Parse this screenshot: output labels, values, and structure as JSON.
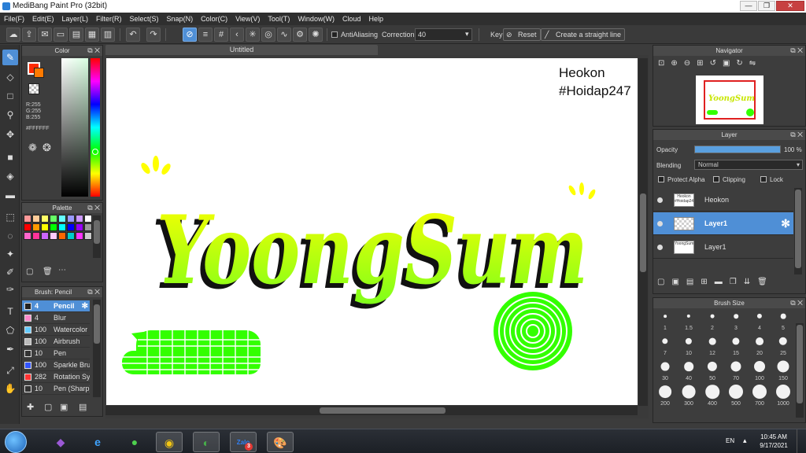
{
  "window": {
    "title": "MediBang Paint Pro (32bit)"
  },
  "menu": [
    "File(F)",
    "Edit(E)",
    "Layer(L)",
    "Filter(R)",
    "Select(S)",
    "Snap(N)",
    "Color(C)",
    "View(V)",
    "Tool(T)",
    "Window(W)",
    "Cloud",
    "Help"
  ],
  "toolbar": {
    "antialiasing_label": "AntiAliasing",
    "correction_label": "Correction",
    "correction_value": "40",
    "key_label": "Key",
    "reset_label": "Reset",
    "straight_line_label": "Create a straight line"
  },
  "color_panel": {
    "title": "Color",
    "r": "R:255",
    "g": "G:255",
    "b": "B:255",
    "hex": "#FFFFFF",
    "primary_color": "#ff2a00",
    "secondary_color": "#ffffff"
  },
  "palette": {
    "title": "Palette",
    "colors": [
      "#ff9999",
      "#ffcc99",
      "#ffff66",
      "#66ff66",
      "#66ffff",
      "#9999ff",
      "#cc99ff",
      "#ffffff",
      "#ff0000",
      "#ff9900",
      "#ffff00",
      "#00ff00",
      "#00ffff",
      "#0000ff",
      "#9900ff",
      "#999999",
      "#ff66cc",
      "#ff3399",
      "#cc66ff",
      "#ffccff",
      "#ff6600",
      "#00cccc",
      "#ff33ff",
      "#cccccc"
    ]
  },
  "brush_panel": {
    "title": "Brush: Pencil",
    "brushes": [
      {
        "size": "4",
        "name": "Pencil",
        "color": "#222222",
        "selected": true
      },
      {
        "size": "4",
        "name": "Blur",
        "color": "#ff88cc",
        "selected": false
      },
      {
        "size": "100",
        "name": "Watercolor",
        "color": "#66ccff",
        "selected": false
      },
      {
        "size": "100",
        "name": "Airbrush",
        "color": "#bbbbbb",
        "selected": false
      },
      {
        "size": "10",
        "name": "Pen",
        "color": "#333333",
        "selected": false
      },
      {
        "size": "100",
        "name": "Sparkle Brush",
        "color": "#3355ff",
        "selected": false
      },
      {
        "size": "282",
        "name": "Rotation Symmetry",
        "color": "#ff3333",
        "selected": false
      },
      {
        "size": "10",
        "name": "Pen (Sharp)",
        "color": "#333333",
        "selected": false
      }
    ]
  },
  "document": {
    "tab": "Untitled",
    "watermark_line1": "Heokon",
    "watermark_line2": "#Hoidap247",
    "artwork_text": "YoongSum"
  },
  "navigator": {
    "title": "Navigator"
  },
  "layer_panel": {
    "title": "Layer",
    "opacity_label": "Opacity",
    "opacity_value": "100 %",
    "opacity": 1.0,
    "blending_label": "Blending",
    "blending_value": "Normal",
    "protect_alpha": "Protect Alpha",
    "clipping": "Clipping",
    "lock": "Lock",
    "layers": [
      {
        "name": "Heokon",
        "thumb": "Heokon #Hoidap247",
        "selected": false
      },
      {
        "name": "Layer1",
        "thumb": "",
        "selected": true
      },
      {
        "name": "Layer1",
        "thumb": "YoongSum",
        "selected": false
      }
    ]
  },
  "brush_size_panel": {
    "title": "Brush Size",
    "sizes": [
      "1",
      "1.5",
      "2",
      "3",
      "4",
      "5",
      "7",
      "10",
      "12",
      "15",
      "20",
      "25",
      "30",
      "40",
      "50",
      "70",
      "100",
      "150",
      "200",
      "300",
      "400",
      "500",
      "700",
      "1000"
    ]
  },
  "taskbar": {
    "lang": "EN",
    "time": "10:45 AM",
    "date": "9/17/2021",
    "zalo_badge": "3"
  }
}
